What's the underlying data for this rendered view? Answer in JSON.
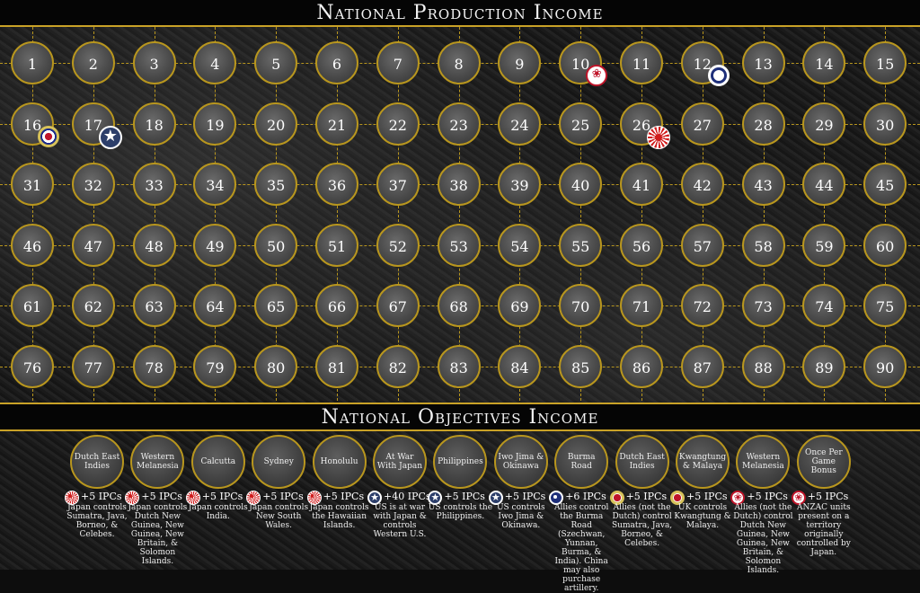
{
  "title": "National Production Income",
  "objectives_title": "National Objectives Income",
  "grid_numbers": [
    "1",
    "2",
    "3",
    "4",
    "5",
    "6",
    "7",
    "8",
    "9",
    "10",
    "11",
    "12",
    "13",
    "14",
    "15",
    "16",
    "17",
    "18",
    "19",
    "20",
    "21",
    "22",
    "23",
    "24",
    "25",
    "26",
    "27",
    "28",
    "29",
    "30",
    "31",
    "32",
    "33",
    "34",
    "35",
    "36",
    "37",
    "38",
    "39",
    "40",
    "41",
    "42",
    "43",
    "44",
    "45",
    "46",
    "47",
    "48",
    "49",
    "50",
    "51",
    "52",
    "53",
    "54",
    "55",
    "56",
    "57",
    "58",
    "59",
    "60",
    "61",
    "62",
    "63",
    "64",
    "65",
    "66",
    "67",
    "68",
    "69",
    "70",
    "71",
    "72",
    "73",
    "74",
    "75",
    "76",
    "77",
    "78",
    "79",
    "80",
    "81",
    "82",
    "83",
    "84",
    "85",
    "86",
    "87",
    "88",
    "89",
    "90"
  ],
  "markers": [
    {
      "nation": "ANZAC",
      "icon": "anzac-roundel-icon",
      "cell": "10"
    },
    {
      "nation": "China",
      "icon": "china-sun-icon",
      "cell": "12"
    },
    {
      "nation": "UK",
      "icon": "uk-roundel-icon",
      "cell": "16"
    },
    {
      "nation": "US",
      "icon": "us-star-icon",
      "cell": "17"
    },
    {
      "nation": "Japan",
      "icon": "japan-sun-icon",
      "cell": "26"
    }
  ],
  "objectives": [
    {
      "name": "Dutch East Indies",
      "value": "+5 IPCs",
      "icon": "japan-sun-icon",
      "desc": "Japan controls Sumatra, Java, Borneo, & Celebes."
    },
    {
      "name": "Western Melanesia",
      "value": "+5 IPCs",
      "icon": "japan-sun-icon",
      "desc": "Japan controls Dutch New Guinea, New Guinea, New Britain, & Solomon Islands."
    },
    {
      "name": "Calcutta",
      "value": "+5 IPCs",
      "icon": "japan-sun-icon",
      "desc": "Japan controls India."
    },
    {
      "name": "Sydney",
      "value": "+5 IPCs",
      "icon": "japan-sun-icon",
      "desc": "Japan controls New South Wales."
    },
    {
      "name": "Honolulu",
      "value": "+5 IPCs",
      "icon": "japan-sun-icon",
      "desc": "Japan controls the Hawaiian Islands."
    },
    {
      "name": "At War With Japan",
      "value": "+40 IPCs",
      "icon": "us-star-icon",
      "desc": "US is at war with Japan & controls Western U.S."
    },
    {
      "name": "Philippines",
      "value": "+5 IPCs",
      "icon": "us-star-icon",
      "desc": "US controls the Philippines."
    },
    {
      "name": "Iwo Jima & Okinawa",
      "value": "+5 IPCs",
      "icon": "us-star-icon",
      "desc": "US controls Iwo Jima & Okinawa."
    },
    {
      "name": "Burma Road",
      "value": "+6 IPCs",
      "icon": "china-sun-icon",
      "desc": "Allies control the Burma Road (Szechwan, Yunnan, Burma, & India). China may also purchase artillery."
    },
    {
      "name": "Dutch East Indies",
      "value": "+5 IPCs",
      "icon": "uk-roundel-icon",
      "desc": "Allies (not the Dutch) control Sumatra, Java, Borneo, & Celebes."
    },
    {
      "name": "Kwangtung & Malaya",
      "value": "+5 IPCs",
      "icon": "uk-roundel-icon",
      "desc": "UK controls Kwangtung & Malaya."
    },
    {
      "name": "Western Melanesia",
      "value": "+5 IPCs",
      "icon": "anzac-roundel-icon",
      "desc": "Allies (not the Dutch) control Dutch New Guinea, New Guinea, New Britain, & Solomon Islands."
    },
    {
      "name": "Once Per Game Bonus",
      "value": "+5 IPCs",
      "icon": "anzac-roundel-icon",
      "desc": "ANZAC units present on a territory originally controlled by Japan."
    }
  ],
  "colors": {
    "gold": "#b8961e",
    "background": "#1a1a1a",
    "japan": "#d01c1c",
    "us": "#2c3e6a",
    "uk": "#1a2a8a",
    "china": "#1e2f7a",
    "anzac": "#c0152a"
  }
}
